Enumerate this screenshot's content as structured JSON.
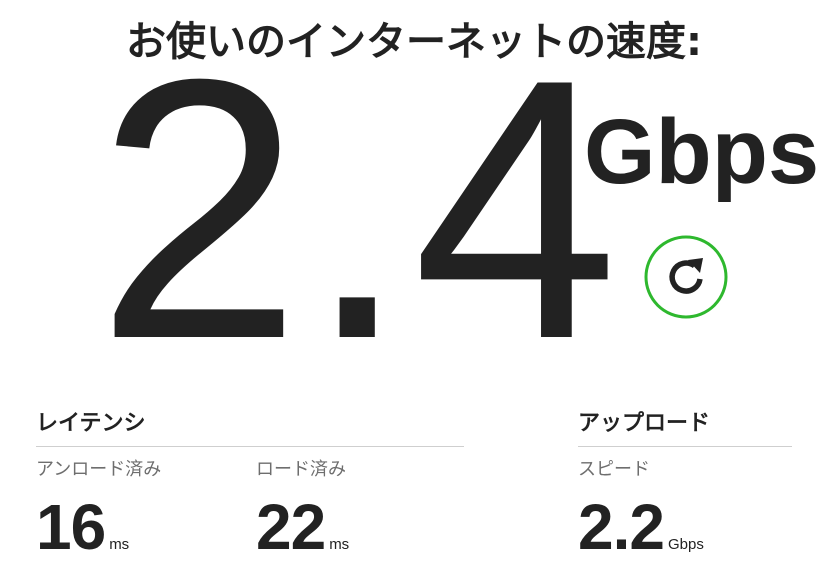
{
  "heading": "お使いのインターネットの速度:",
  "speed": {
    "value": "2.4",
    "unit": "Gbps"
  },
  "refresh": {
    "icon": "refresh-icon",
    "ring_color": "#2eb82e"
  },
  "latency": {
    "title": "レイテンシ",
    "unloaded": {
      "label": "アンロード済み",
      "value": "16",
      "unit": "ms"
    },
    "loaded": {
      "label": "ロード済み",
      "value": "22",
      "unit": "ms"
    }
  },
  "upload": {
    "title": "アップロード",
    "speed": {
      "label": "スピード",
      "value": "2.2",
      "unit": "Gbps"
    }
  }
}
